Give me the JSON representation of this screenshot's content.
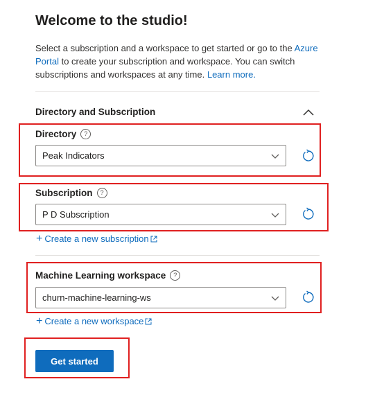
{
  "header": {
    "title": "Welcome to the studio!"
  },
  "intro": {
    "text_before_link": "Select a subscription and a workspace to get started or go to the ",
    "portal_link": "Azure Portal",
    "text_after_link": " to create your subscription and workspace. You can switch subscriptions and workspaces at any time. ",
    "learn_more_link": "Learn more."
  },
  "section": {
    "title": "Directory and Subscription",
    "collapse_icon": "chevron-up-icon"
  },
  "directory": {
    "label": "Directory",
    "help_glyph": "?",
    "value": "Peak Indicators",
    "refresh_icon": "refresh-icon"
  },
  "subscription": {
    "label": "Subscription",
    "help_glyph": "?",
    "value": "P D Subscription",
    "create_link": "Create a new subscription",
    "refresh_icon": "refresh-icon"
  },
  "workspace": {
    "label": "Machine Learning workspace",
    "help_glyph": "?",
    "value": "churn-machine-learning-ws",
    "create_link": "Create a new workspace",
    "refresh_icon": "refresh-icon"
  },
  "actions": {
    "get_started": "Get started"
  },
  "colors": {
    "accent": "#0f6cbd",
    "highlight_box": "#e02020"
  }
}
